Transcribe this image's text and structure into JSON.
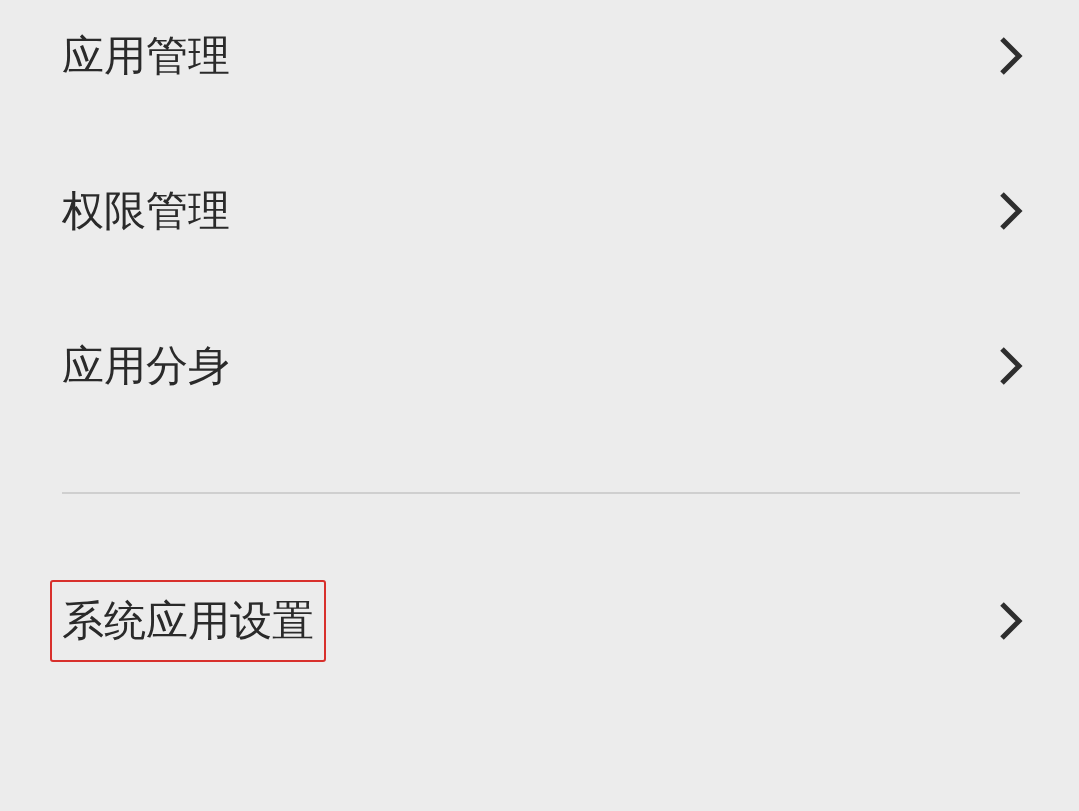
{
  "sections": [
    {
      "items": [
        {
          "label": "应用管理",
          "highlighted": false
        },
        {
          "label": "权限管理",
          "highlighted": false
        },
        {
          "label": "应用分身",
          "highlighted": false
        }
      ]
    },
    {
      "items": [
        {
          "label": "系统应用设置",
          "highlighted": true
        }
      ]
    }
  ]
}
